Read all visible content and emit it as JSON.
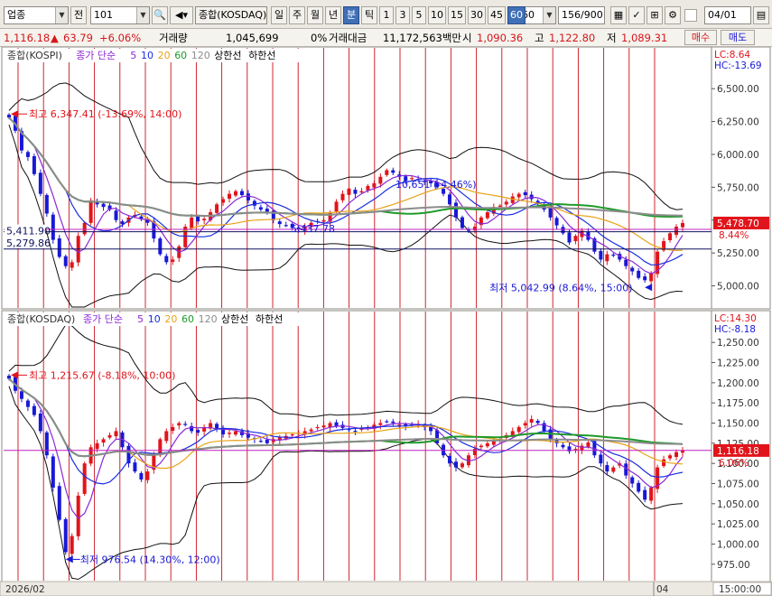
{
  "toolbar": {
    "market_select": "업종",
    "prev_label": "전",
    "code": "101",
    "name_field": "종합(KOSDAQ)",
    "periods": [
      "일",
      "주",
      "월",
      "년",
      "분",
      "틱",
      "1",
      "3",
      "5",
      "10",
      "15",
      "30",
      "45",
      "60"
    ],
    "active_periods": [
      "분",
      "60"
    ],
    "interval_select": "60",
    "count": "156/900",
    "date": "04/01"
  },
  "quote": {
    "price": "1,116.18",
    "change_arrow": "▲",
    "change": "63.79",
    "change_pct": "+6.06%",
    "volume_label": "거래량",
    "volume": "1,045,699",
    "volume_pct": "0%",
    "amount_label": "거래대금",
    "amount": "11,172,563백만",
    "open_label": "시",
    "open": "1,090.36",
    "high_label": "고",
    "high": "1,122.80",
    "low_label": "저",
    "low": "1,089.31",
    "buy_label": "매수",
    "sell_label": "매도"
  },
  "colors": {
    "up": "#e1141b",
    "down": "#1818d6",
    "ma5": "#8b28d6",
    "ma10": "#1a2ee0",
    "ma20": "#e8a317",
    "ma60": "#1f9a2a",
    "ma120": "#8c8c8c",
    "vline": "#c8101a"
  },
  "top_panel": {
    "legend_name": "종합(KOSPI)",
    "legend_parts": [
      {
        "text": "종가 단순",
        "color": "#8b28d6"
      },
      {
        "text": "5",
        "color": "#8b28d6"
      },
      {
        "text": "10",
        "color": "#1a2ee0"
      },
      {
        "text": "20",
        "color": "#e8a317"
      },
      {
        "text": "60",
        "color": "#1f9a2a"
      },
      {
        "text": "120",
        "color": "#8c8c8c"
      },
      {
        "text": "상한선",
        "color": "#000000"
      },
      {
        "text": "하한선",
        "color": "#000000"
      }
    ],
    "lc": "LC:8.64",
    "hc": "HC:-13.69",
    "current_price": "5,478.70",
    "current_pct": "8.44%",
    "y_ticks": [
      "6,500.00",
      "6,250.00",
      "6,000.00",
      "5,750.00",
      "5,500.00",
      "5,250.00",
      "5,000.00"
    ],
    "ymin": 4880,
    "ymax": 6680,
    "labels": {
      "high": "최고 6,347.41 (-13.69%, 14:00)",
      "low": "최저 5,042.99 (8.64%, 15:00)",
      "mid1": "10,651 (-4.46%)",
      "mid2": "5,437.78",
      "hline1": "5,411.90",
      "hline2": "5,279.86"
    },
    "hlines": [
      5411.9,
      5279.86,
      5430
    ],
    "closes": [
      6280,
      6180,
      6030,
      5980,
      5850,
      5700,
      5550,
      5350,
      5220,
      5150,
      5180,
      5380,
      5480,
      5650,
      5620,
      5600,
      5580,
      5500,
      5470,
      5520,
      5540,
      5510,
      5480,
      5360,
      5240,
      5180,
      5200,
      5300,
      5450,
      5520,
      5490,
      5510,
      5560,
      5620,
      5660,
      5700,
      5720,
      5690,
      5650,
      5610,
      5580,
      5560,
      5500,
      5470,
      5460,
      5440,
      5430,
      5450,
      5480,
      5490,
      5500,
      5560,
      5640,
      5700,
      5740,
      5700,
      5720,
      5760,
      5780,
      5830,
      5880,
      5860,
      5830,
      5800,
      5820,
      5810,
      5790,
      5780,
      5750,
      5700,
      5620,
      5520,
      5440,
      5420,
      5450,
      5520,
      5560,
      5600,
      5610,
      5640,
      5680,
      5700,
      5690,
      5660,
      5620,
      5580,
      5520,
      5460,
      5400,
      5330,
      5380,
      5420,
      5350,
      5260,
      5200,
      5240,
      5230,
      5200,
      5150,
      5110,
      5060,
      5043,
      5100,
      5260,
      5340,
      5400,
      5450,
      5478
    ]
  },
  "bottom_panel": {
    "legend_name": "종합(KOSDAQ)",
    "legend_parts": [
      {
        "text": "종가 단순",
        "color": "#8b28d6"
      },
      {
        "text": "5",
        "color": "#8b28d6"
      },
      {
        "text": "10",
        "color": "#1a2ee0"
      },
      {
        "text": "20",
        "color": "#e8a317"
      },
      {
        "text": "60",
        "color": "#1f9a2a"
      },
      {
        "text": "120",
        "color": "#8c8c8c"
      },
      {
        "text": "상한선",
        "color": "#000000"
      },
      {
        "text": "하한선",
        "color": "#000000"
      }
    ],
    "lc": "LC:14.30",
    "hc": "HC:-8.18",
    "current_price": "1,116.18",
    "current_pct": "6.06%",
    "y_ticks": [
      "1,250.00",
      "1,225.00",
      "1,200.00",
      "1,175.00",
      "1,150.00",
      "1,125.00",
      "1,100.00",
      "1,075.00",
      "1,050.00",
      "1,025.00",
      "1,000.00",
      "975.00"
    ],
    "ymin": 958,
    "ymax": 1267,
    "labels": {
      "high": "최고 1,215.67 (-8.18%, 10:00)",
      "low": "최저 976.54 (14.30%, 12:00)"
    },
    "hlines": [
      1116.18
    ],
    "closes": [
      1205,
      1190,
      1180,
      1170,
      1160,
      1140,
      1110,
      1070,
      1030,
      990,
      1010,
      1060,
      1100,
      1120,
      1125,
      1130,
      1135,
      1140,
      1120,
      1100,
      1090,
      1080,
      1090,
      1110,
      1130,
      1140,
      1145,
      1150,
      1148,
      1140,
      1138,
      1145,
      1150,
      1142,
      1136,
      1138,
      1140,
      1135,
      1132,
      1130,
      1128,
      1125,
      1130,
      1132,
      1134,
      1136,
      1138,
      1140,
      1142,
      1145,
      1147,
      1150,
      1146,
      1144,
      1142,
      1140,
      1143,
      1145,
      1148,
      1150,
      1152,
      1150,
      1148,
      1146,
      1148,
      1149,
      1145,
      1140,
      1125,
      1110,
      1100,
      1095,
      1100,
      1110,
      1118,
      1122,
      1125,
      1128,
      1130,
      1135,
      1140,
      1145,
      1150,
      1155,
      1150,
      1140,
      1130,
      1125,
      1120,
      1115,
      1118,
      1122,
      1126,
      1110,
      1100,
      1090,
      1095,
      1100,
      1085,
      1075,
      1065,
      1055,
      1070,
      1095,
      1105,
      1110,
      1114,
      1116
    ]
  },
  "x_axis": {
    "start_label": "2026/02",
    "month_label": "04",
    "time_label": "15:00:00"
  }
}
